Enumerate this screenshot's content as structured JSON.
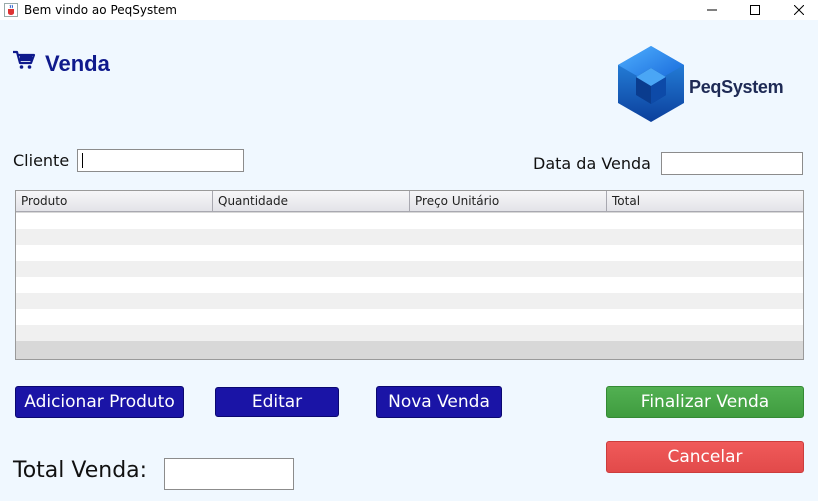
{
  "window": {
    "title": "Bem vindo ao PeqSystem",
    "icons": {
      "app": "java-cup-icon",
      "minimize": "minimize-icon",
      "maximize": "maximize-icon",
      "close": "close-icon"
    }
  },
  "header": {
    "title": "Venda",
    "title_icon": "shopping-cart-icon",
    "logo_text": "PeqSystem"
  },
  "form": {
    "cliente_label": "Cliente",
    "cliente_value": "",
    "data_label": "Data da Venda",
    "data_value": ""
  },
  "table": {
    "columns": [
      "Produto",
      "Quantidade",
      "Preço Unitário",
      "Total"
    ],
    "rows": []
  },
  "buttons": {
    "adicionar": "Adicionar Produto",
    "editar": "Editar",
    "nova": "Nova Venda",
    "finalizar": "Finalizar Venda",
    "cancelar": "Cancelar"
  },
  "footer": {
    "total_label": "Total Venda:",
    "total_value": ""
  },
  "colors": {
    "primary_blue": "#1a14a6",
    "title_blue": "#0f1a8c",
    "success_green": "#4caf50",
    "danger_red": "#ee5555",
    "background": "#f0f8ff"
  }
}
